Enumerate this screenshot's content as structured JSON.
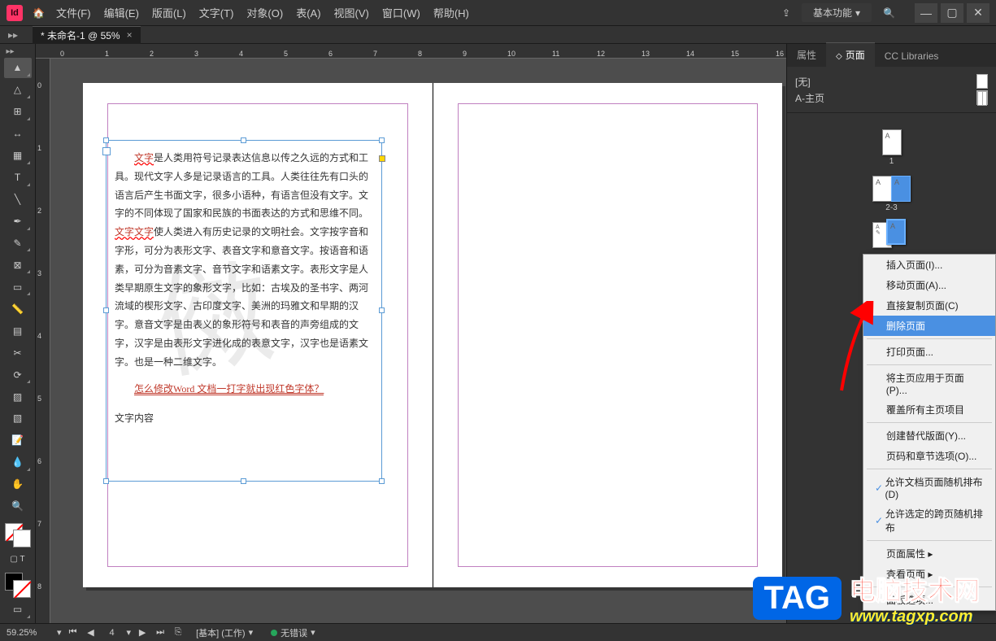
{
  "app": {
    "logo": "Id"
  },
  "menu": [
    "文件(F)",
    "编辑(E)",
    "版面(L)",
    "文字(T)",
    "对象(O)",
    "表(A)",
    "视图(V)",
    "窗口(W)",
    "帮助(H)"
  ],
  "workspace": "基本功能",
  "tab": {
    "title": "* 未命名-1 @ 55%",
    "close": "×"
  },
  "rulerH": [
    "0",
    "1",
    "2",
    "3",
    "4",
    "5",
    "6",
    "7",
    "8",
    "9",
    "10",
    "11",
    "12",
    "13",
    "14",
    "15",
    "16"
  ],
  "rulerV": [
    "0",
    "1",
    "2",
    "3",
    "4",
    "5",
    "6",
    "7",
    "8"
  ],
  "panel": {
    "tabs": [
      "属性",
      "页面",
      "CC Libraries"
    ],
    "masters": {
      "none": "[无]",
      "aMaster": "A-主页"
    },
    "pageLabels": [
      "1",
      "2-3"
    ]
  },
  "contextMenu": {
    "items": [
      "插入页面(I)...",
      "移动页面(A)...",
      "直接复制页面(C)",
      "删除页面",
      "打印页面...",
      "将主页应用于页面(P)...",
      "覆盖所有主页项目",
      "创建替代版面(Y)...",
      "页码和章节选项(O)...",
      "允许文档页面随机排布(D)",
      "允许选定的跨页随机排布",
      "页面属性",
      "查看页面",
      "面板选项..."
    ]
  },
  "statusBar": {
    "zoom": "59.25%",
    "page": "4",
    "profile": "[基本]  (工作)",
    "errors": "无错误"
  },
  "document": {
    "para1a": "文字",
    "para1b": "是人类用符号记录表达信息以传之久远的方式和工具。现代文字人多是记录语言的工具。人类往往先有口头的语言后产生书面文字，很多小语种，有语言但没有文字。文字的不同体现了国家和民族的书面表达的方式和思维不同。",
    "para1c": "文字文字",
    "para1d": "使人类进入有历史记录的文明社会。文字按字音和字形，可分为表形文字、表音文字和意音文字。按语音和语素，可分为音素文字、音节文字和语素文字。表形文字是人类早期原生文字的象形文字，比如：古埃及的圣书字、两河流域的楔形文字、古印度文字、美洲的玛雅文和早期的汉字。意音文字是由表义的象形符号和表音的声旁组成的文字，汉字是由表形文字进化成的表意文字，汉字也是语素文字。也是一种二维文字。",
    "link": "怎么修改Word 文档一打字就出现红色字体？",
    "label": "文字内容",
    "watermark": "傚"
  },
  "overlay": {
    "tag": "TAG",
    "cn": "电脑技术网",
    "url": "www.tagxp.com"
  }
}
